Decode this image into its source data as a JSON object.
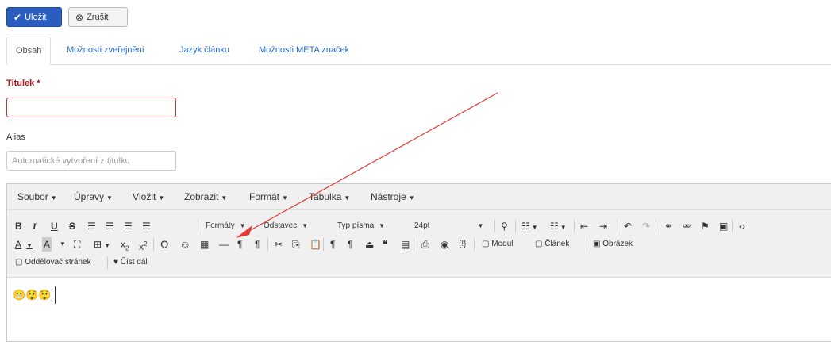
{
  "buttons": {
    "save_label": "Uložit",
    "cancel_label": "Zrušit"
  },
  "tabs": [
    {
      "label": "Obsah",
      "active": true
    },
    {
      "label": "Možnosti zveřejnění",
      "active": false
    },
    {
      "label": "Jazyk článku",
      "active": false
    },
    {
      "label": "Možnosti META značek",
      "active": false
    }
  ],
  "form": {
    "title_label": "Titulek",
    "title_required": "*",
    "title_value": "",
    "alias_label": "Alias",
    "alias_placeholder": "Automatické vytvoření z titulku"
  },
  "editor": {
    "menus": [
      "Soubor",
      "Úpravy",
      "Vložit",
      "Zobrazit",
      "Formát",
      "Tabulka",
      "Nástroje"
    ],
    "dropdowns": {
      "formats": "Formáty",
      "block": "Odstavec",
      "font_family": "Typ písma",
      "font_size": "24pt"
    },
    "buttons": {
      "module": "Modul",
      "article": "Článek",
      "image": "Obrázek",
      "pagebreak": "Oddělovač stránek",
      "readmore": "Číst dál"
    },
    "content_emojis": "😬😲😲"
  },
  "colors": {
    "primary": "#2a5dbf",
    "required": "#a51c1c",
    "annotation_arrow": "#e53935"
  }
}
